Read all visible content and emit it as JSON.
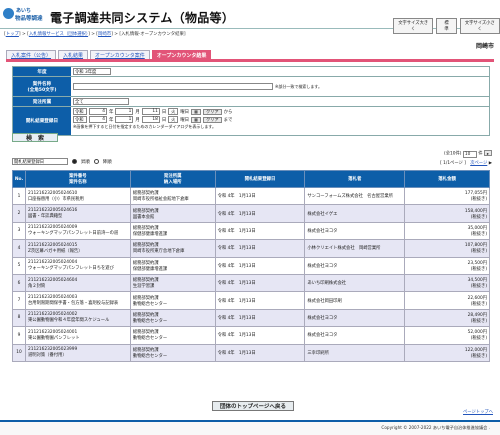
{
  "header": {
    "logo_line1": "あいち",
    "logo_line2": "物品等調達",
    "title": "電子調達共同システム（物品等）",
    "size_buttons": [
      "文字サイズ大きく",
      "標　準",
      "文字サイズ小さく"
    ]
  },
  "breadcrumb": {
    "items": [
      "トップ",
      "入札情報サービス（団体選択）",
      "岡崎市"
    ],
    "current": "入札情報-オープンカウンタ結果"
  },
  "city": "岡崎市",
  "tabs": [
    "入札案件（公告）",
    "入札結果",
    "オープンカウンタ案件",
    "オープンカウンタ結果"
  ],
  "form": {
    "year_label": "年度",
    "year_value": "令和 3年度",
    "name_label1": "案件名称",
    "name_label2": "(全角50文字)",
    "name_note": "※部分一致で検索します。",
    "section_label": "発注所属",
    "section_value": "全て",
    "date_label": "開札結果登録日",
    "from_era": "令和",
    "from_y": "4",
    "from_m": "1",
    "from_d": "11",
    "from_dow": "火",
    "from_dow_suffix": "曜日",
    "clear": "クリア",
    "from_word": "から",
    "to_era": "令和",
    "to_y": "4",
    "to_m": "1",
    "to_d": "18",
    "to_dow": "火",
    "to_dow_suffix": "曜日",
    "to_word": "まで",
    "date_note": "※画像を押下すると日付を指定するためのカレンダーダイアログを表示します。",
    "search_label": "検　索"
  },
  "sort": {
    "select_value": "開札結果登録日",
    "asc": "昇順",
    "desc": "降順"
  },
  "meta": {
    "count_prefix": "(全10件)",
    "per_page": "10",
    "per_suffix": "件",
    "page": "[ 1/1ページ ]",
    "next": "次ページ"
  },
  "table": {
    "headers": {
      "no": "No.",
      "case_no": "案件番号",
      "case_name": "案件名称",
      "section1": "発注所属",
      "section2": "納入場所",
      "date": "開札結果登録日",
      "winner": "落札者",
      "amount": "落札金額"
    },
    "rows": [
      {
        "no": "1",
        "code": "211216232005024610",
        "name": "口座振替用（小）市県民税用",
        "sec1": "総務部契約課",
        "sec2": "岡崎市役所福祉会館地下倉庫",
        "date": "令和 4年　1月13日",
        "winner": "サンコーフォームズ株式会社　名古屋営業所",
        "amount": "177,055円",
        "tax": "(税抜き)"
      },
      {
        "no": "2",
        "code": "211216232005024616",
        "name": "図書・年誌典籍型",
        "sec1": "総務部契約課",
        "sec2": "図書本会館",
        "date": "令和 4年　1月13日",
        "winner": "株式会社イゲエ",
        "amount": "158,400円",
        "tax": "(税抜き)"
      },
      {
        "no": "3",
        "code": "211216232005024009",
        "name": "ウォーキングマップパンフレット日前湾一の道",
        "sec1": "総務部契約課",
        "sec2": "保健部健康増進課",
        "date": "令和 4年　1月13日",
        "winner": "株式会社ヨコタ",
        "amount": "35,000円",
        "tax": "(税抜き)"
      },
      {
        "no": "4",
        "code": "211216232005024015",
        "name": "Z茨区幕バガキ用紙（報告）",
        "sec1": "総務部契約課",
        "sec2": "岡崎市役所東庁舎地下倉庫",
        "date": "令和 4年　1月13日",
        "winner": "小林クリエイト株式会社　岡崎営業所",
        "amount": "107,800円",
        "tax": "(税抜き)"
      },
      {
        "no": "5",
        "code": "211216232005024004",
        "name": "ウォーキングマップパンフレット日ちを遊び",
        "sec1": "総務部契約課",
        "sec2": "保健部健康増進課",
        "date": "令和 4年　1月13日",
        "winner": "株式会社ヨコタ",
        "amount": "23,500円",
        "tax": "(税抜き)"
      },
      {
        "no": "6",
        "code": "211216232005024604",
        "name": "角２封筒",
        "sec1": "総務部契約課",
        "sec2": "生涯学習課",
        "date": "令和 4年　1月13日",
        "winner": "あいち印刷株式会社",
        "amount": "34,500円",
        "tax": "(税抜き)"
      },
      {
        "no": "7",
        "code": "211216232005024003",
        "name": "台用制限期間保手書・包方落・喜剤投与記録表",
        "sec1": "総務部契約課",
        "sec2": "動物総合センター",
        "date": "令和 4年　1月13日",
        "winner": "株式会社岡田印刷",
        "amount": "22,600円",
        "tax": "(税抜き)"
      },
      {
        "no": "8",
        "code": "211216232005024002",
        "name": "東公園動物園今和４年度年間スケジュール",
        "sec1": "総務部契約課",
        "sec2": "動物総合センター",
        "date": "令和 4年　1月13日",
        "winner": "株式会社ヨコタ",
        "amount": "28,490円",
        "tax": "(税抜き)"
      },
      {
        "no": "9",
        "code": "211216232005024001",
        "name": "東公園動物園パンフレット",
        "sec1": "総務部契約課",
        "sec2": "動物総合センター",
        "date": "令和 4年　1月13日",
        "winner": "株式会社ヨコタ",
        "amount": "52,000円",
        "tax": "(税抜き)"
      },
      {
        "no": "10",
        "code": "211216232005023999",
        "name": "道明対策（番付用）",
        "sec1": "総務部契約課",
        "sec2": "動物総合センター",
        "date": "令和 4年　1月13日",
        "winner": "三幸印刷所",
        "amount": "122,000円",
        "tax": "(税抜き)"
      }
    ]
  },
  "back_button": "団体のトップページへ戻る",
  "page_top": "ページトップへ",
  "copyright": "Copyright © 2007-2022 あいち電子自治体推進協議会 ."
}
